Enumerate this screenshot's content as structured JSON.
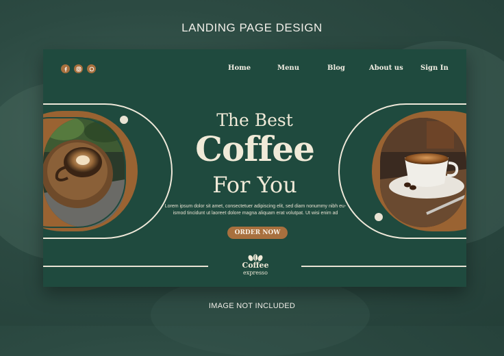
{
  "captions": {
    "top": "LANDING PAGE DESIGN",
    "bottom": "IMAGE NOT INCLUDED"
  },
  "social_icons": [
    "facebook-icon",
    "instagram-icon",
    "whatsapp-icon"
  ],
  "nav": {
    "items": [
      "Home",
      "Menu",
      "Blog",
      "About us",
      "Sign In"
    ]
  },
  "hero": {
    "line1": "The Best",
    "line2": "Coffee",
    "line3": "For You",
    "description": "Lorem ipsum dolor sit amet, consectetuer adipiscing elit, sed diam nonummy nibh eu-ismod tincidunt ut laoreet dolore magna aliquam erat volutpat. Ut wisi enim ad",
    "button": "ORDER NOW"
  },
  "logo": {
    "line1": "Coffee",
    "line2": "expresso",
    "icon": "coffee-beans-icon"
  },
  "colors": {
    "background": "#2c4a42",
    "card": "#1f4a3e",
    "accent": "#a8703e",
    "cream": "#f0ead8"
  }
}
